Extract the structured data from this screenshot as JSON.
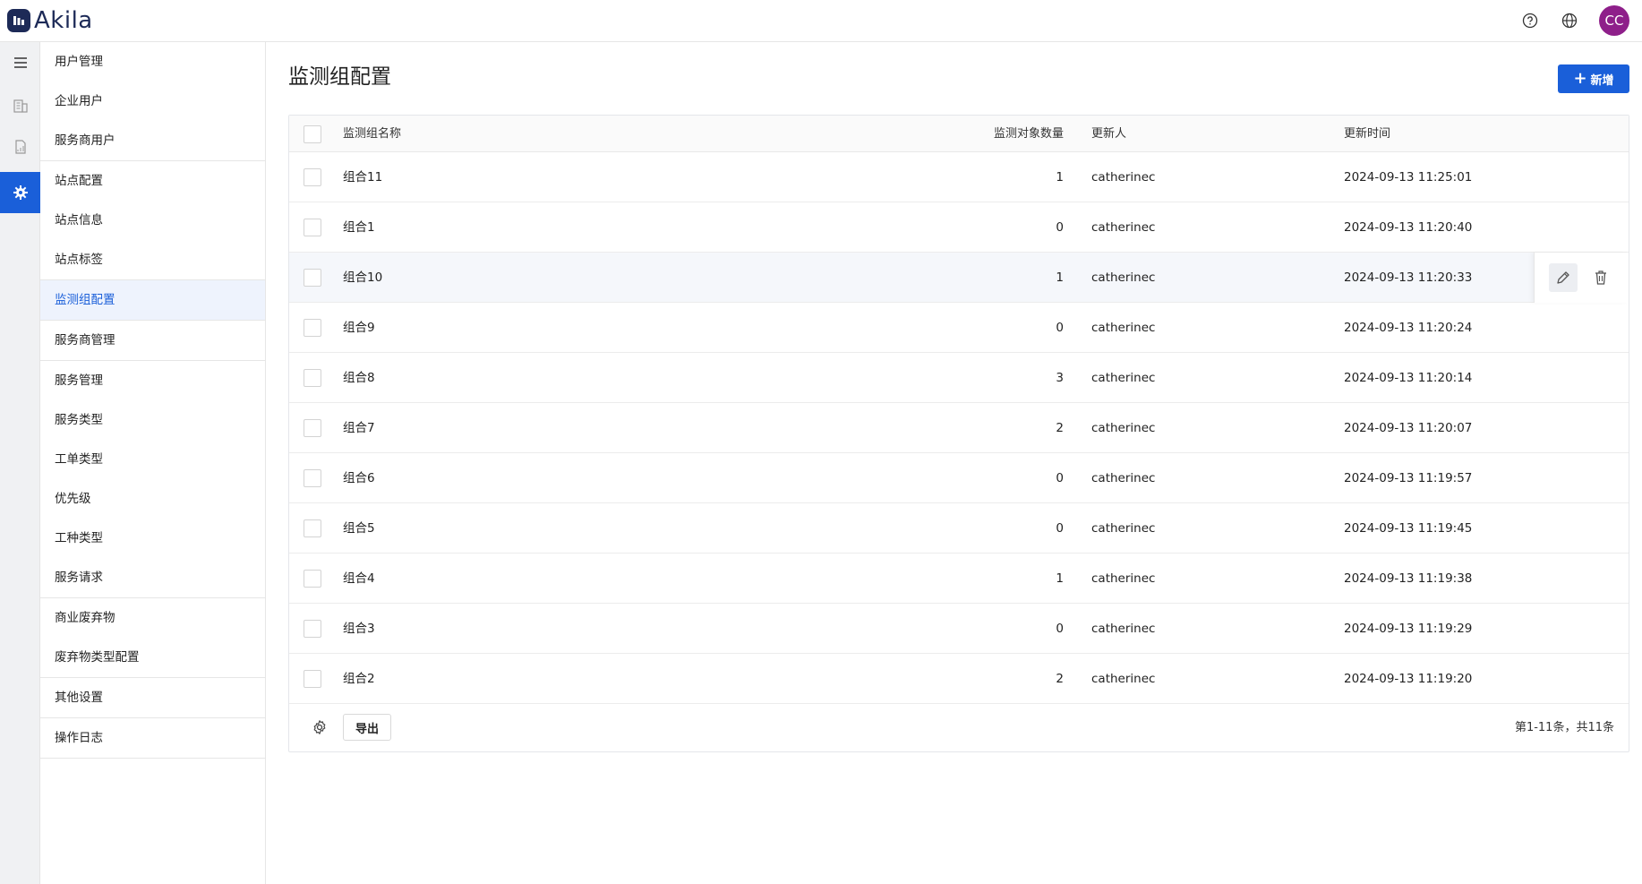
{
  "app": {
    "logo_text": "Akila",
    "avatar_initials": "CC",
    "brand_color": "#1a5fd9",
    "avatar_color": "#8e1f8a"
  },
  "sidebar": {
    "groups": [
      {
        "items": [
          {
            "label": "用户管理"
          },
          {
            "label": "企业用户"
          },
          {
            "label": "服务商用户"
          }
        ]
      },
      {
        "items": [
          {
            "label": "站点配置"
          },
          {
            "label": "站点信息"
          },
          {
            "label": "站点标签"
          }
        ]
      },
      {
        "items": [
          {
            "label": "监测组配置",
            "active": true
          }
        ]
      },
      {
        "items": [
          {
            "label": "服务商管理"
          }
        ]
      },
      {
        "items": [
          {
            "label": "服务管理"
          },
          {
            "label": "服务类型"
          },
          {
            "label": "工单类型"
          },
          {
            "label": "优先级"
          },
          {
            "label": "工种类型"
          },
          {
            "label": "服务请求"
          }
        ]
      },
      {
        "items": [
          {
            "label": "商业废弃物"
          },
          {
            "label": "废弃物类型配置"
          }
        ]
      },
      {
        "items": [
          {
            "label": "其他设置"
          }
        ]
      },
      {
        "items": [
          {
            "label": "操作日志"
          }
        ]
      }
    ]
  },
  "main": {
    "title": "监测组配置",
    "add_button_label": "新增",
    "table": {
      "columns": {
        "name": "监测组名称",
        "count": "监测对象数量",
        "updater": "更新人",
        "updated_at": "更新时间"
      },
      "rows": [
        {
          "name": "组合11",
          "count": "1",
          "updater": "catherinec",
          "updated_at": "2024-09-13 11:25:01"
        },
        {
          "name": "组合1",
          "count": "0",
          "updater": "catherinec",
          "updated_at": "2024-09-13 11:20:40"
        },
        {
          "name": "组合10",
          "count": "1",
          "updater": "catherinec",
          "updated_at": "2024-09-13 11:20:33"
        },
        {
          "name": "组合9",
          "count": "0",
          "updater": "catherinec",
          "updated_at": "2024-09-13 11:20:24"
        },
        {
          "name": "组合8",
          "count": "3",
          "updater": "catherinec",
          "updated_at": "2024-09-13 11:20:14"
        },
        {
          "name": "组合7",
          "count": "2",
          "updater": "catherinec",
          "updated_at": "2024-09-13 11:20:07"
        },
        {
          "name": "组合6",
          "count": "0",
          "updater": "catherinec",
          "updated_at": "2024-09-13 11:19:57"
        },
        {
          "name": "组合5",
          "count": "0",
          "updater": "catherinec",
          "updated_at": "2024-09-13 11:19:45"
        },
        {
          "name": "组合4",
          "count": "1",
          "updater": "catherinec",
          "updated_at": "2024-09-13 11:19:38"
        },
        {
          "name": "组合3",
          "count": "0",
          "updater": "catherinec",
          "updated_at": "2024-09-13 11:19:29"
        },
        {
          "name": "组合2",
          "count": "2",
          "updater": "catherinec",
          "updated_at": "2024-09-13 11:19:20"
        }
      ],
      "hovered_row": 2
    },
    "footer": {
      "export_label": "导出",
      "pagination_text": "第1-11条，共11条"
    }
  }
}
